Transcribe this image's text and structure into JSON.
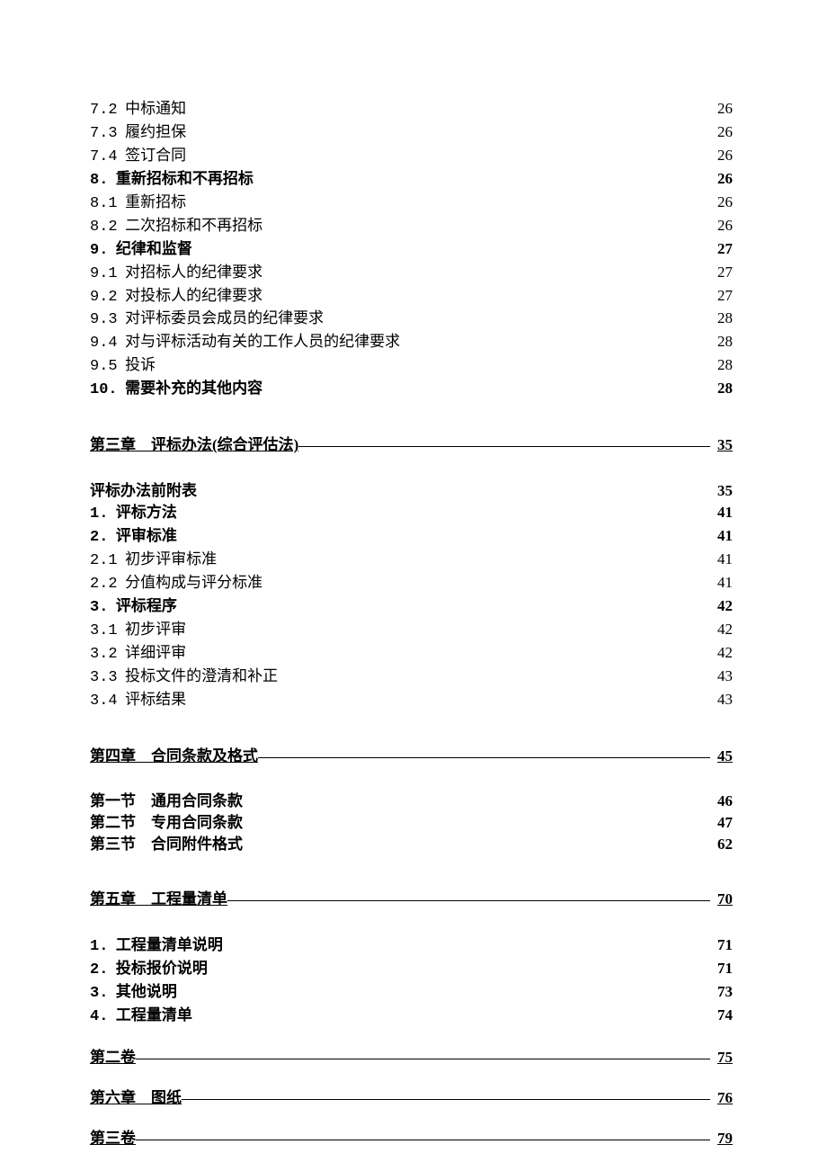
{
  "toc": [
    {
      "type": "item",
      "num": "7.2",
      "text": "中标通知",
      "page": "26"
    },
    {
      "type": "item",
      "num": "7.3",
      "text": "履约担保",
      "page": "26"
    },
    {
      "type": "item",
      "num": "7.4",
      "text": "签订合同",
      "page": "26"
    },
    {
      "type": "bold",
      "num": "8.",
      "text": "重新招标和不再招标",
      "page": "26"
    },
    {
      "type": "item",
      "num": "8.1",
      "text": "重新招标",
      "page": "26"
    },
    {
      "type": "item",
      "num": "8.2",
      "text": "二次招标和不再招标",
      "page": "26"
    },
    {
      "type": "bold",
      "num": "9.",
      "text": "纪律和监督",
      "page": "27"
    },
    {
      "type": "item",
      "num": "9.1",
      "text": "对招标人的纪律要求",
      "page": "27"
    },
    {
      "type": "item",
      "num": "9.2",
      "text": "对投标人的纪律要求",
      "page": "27"
    },
    {
      "type": "item",
      "num": "9.3",
      "text": "对评标委员会成员的纪律要求",
      "page": "28"
    },
    {
      "type": "item",
      "num": "9.4",
      "text": "对与评标活动有关的工作人员的纪律要求",
      "page": "28"
    },
    {
      "type": "item",
      "num": "9.5",
      "text": "投诉",
      "page": "28"
    },
    {
      "type": "bold",
      "num": "10.",
      "text": "需要补充的其他内容",
      "page": "28"
    },
    {
      "type": "heading",
      "text": "第三章　评标办法(综合评估法)",
      "page": "35"
    },
    {
      "type": "bold",
      "text": "评标办法前附表",
      "page": "35"
    },
    {
      "type": "bold",
      "num": "1.",
      "text": "评标方法",
      "page": "41"
    },
    {
      "type": "bold",
      "num": "2.",
      "text": "评审标准",
      "page": "41"
    },
    {
      "type": "item",
      "num": "2.1",
      "text": "初步评审标准",
      "page": "41"
    },
    {
      "type": "item",
      "num": "2.2",
      "text": "分值构成与评分标准",
      "page": "41"
    },
    {
      "type": "bold",
      "num": "3.",
      "text": "评标程序",
      "page": "42"
    },
    {
      "type": "item",
      "num": "3.1",
      "text": "初步评审",
      "page": "42"
    },
    {
      "type": "item",
      "num": "3.2",
      "text": "详细评审",
      "page": "42"
    },
    {
      "type": "item",
      "num": "3.3",
      "text": "投标文件的澄清和补正",
      "page": "43"
    },
    {
      "type": "item",
      "num": "3.4",
      "text": "评标结果",
      "page": "43"
    },
    {
      "type": "heading",
      "text": "第四章　合同条款及格式",
      "page": "45"
    },
    {
      "type": "bold",
      "text": "第一节　通用合同条款",
      "page": "46"
    },
    {
      "type": "bold",
      "text": "第二节　专用合同条款",
      "page": "47"
    },
    {
      "type": "bold",
      "text": "第三节　合同附件格式",
      "page": "62"
    },
    {
      "type": "heading",
      "text": "第五章　工程量清单",
      "page": "70"
    },
    {
      "type": "bold",
      "num": "1.",
      "text": "工程量清单说明",
      "page": "71"
    },
    {
      "type": "bold",
      "num": "2.",
      "text": "投标报价说明",
      "page": "71"
    },
    {
      "type": "bold",
      "num": "3.",
      "text": "其他说明",
      "page": "73"
    },
    {
      "type": "bold",
      "num": "4.",
      "text": "工程量清单",
      "page": "74"
    },
    {
      "type": "heading-tight",
      "text": "第二卷",
      "page": "75"
    },
    {
      "type": "heading-tight",
      "text": "第六章　图纸",
      "page": "76"
    },
    {
      "type": "heading-tight",
      "text": "第三卷",
      "page": "79"
    }
  ]
}
